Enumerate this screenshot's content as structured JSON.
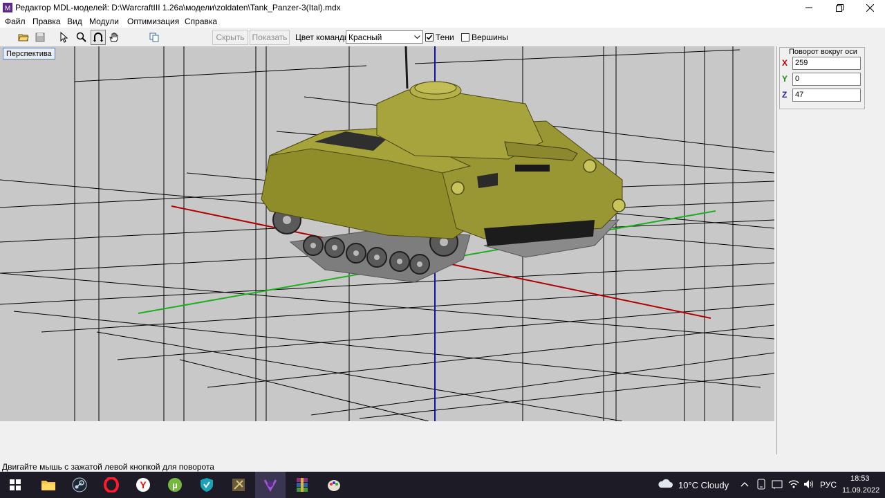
{
  "window": {
    "title": "Редактор MDL-моделей: D:\\WarcraftIII 1.26a\\модели\\zoldaten\\Tank_Panzer-3(Ital).mdx"
  },
  "menu": [
    "Файл",
    "Правка",
    "Вид",
    "Модули",
    "Оптимизация",
    "Справка"
  ],
  "toolbar": {
    "hide_label": "Скрыть",
    "show_label": "Показать",
    "team_color_label": "Цвет команды:",
    "team_color_value": "Красный",
    "shadows_label": "Тени",
    "shadows_checked": true,
    "vertices_label": "Вершины",
    "vertices_checked": false
  },
  "viewport": {
    "view_mode": "Перспектива",
    "background": "#c8c8c8",
    "axis_colors": {
      "x": "#b00000",
      "y": "#1fae1f",
      "z": "#1010a0"
    },
    "model_color": "#8f8d2a"
  },
  "rotation_panel": {
    "title": "Поворот вокруг оси",
    "x_label": "X",
    "x_value": "259",
    "y_label": "Y",
    "y_value": "0",
    "z_label": "Z",
    "z_value": "47"
  },
  "status_bar": {
    "text": "Двигайте мышь с зажатой левой кнопкой для поворота"
  },
  "taskbar": {
    "apps": [
      "windows-start",
      "file-explorer",
      "steam",
      "opera",
      "yandex-browser",
      "utorrent",
      "shield-app",
      "warcraft-tool",
      "mdl-editor",
      "winrar",
      "paint-app"
    ],
    "weather": "10°C  Cloudy",
    "language": "РУС",
    "time": "18:53",
    "date": "11.09.2022"
  }
}
